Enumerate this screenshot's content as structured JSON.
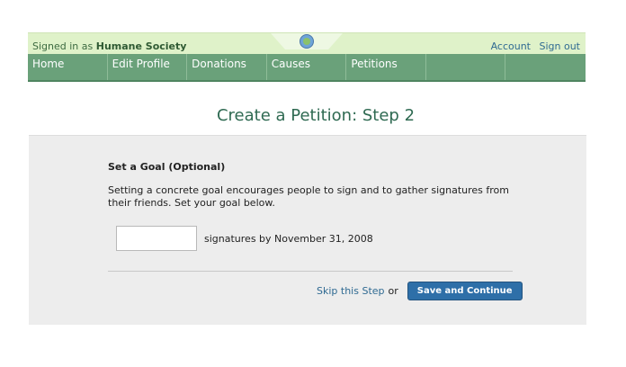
{
  "topbar": {
    "signed_prefix": "Signed in as ",
    "user": "Humane Society",
    "links": [
      "Account",
      "Sign out"
    ]
  },
  "nav": {
    "items": [
      "Home",
      "Edit Profile",
      "Donations",
      "Causes",
      "Petitions",
      "",
      ""
    ]
  },
  "page": {
    "title": "Create a Petition: Step 2"
  },
  "goal": {
    "heading": "Set a Goal (Optional)",
    "description": "Setting a concrete goal encourages people to sign and to gather signatures from their friends. Set your goal below.",
    "input_value": "",
    "suffix": "signatures by November 31, 2008"
  },
  "actions": {
    "skip": "Skip this Step",
    "or": "or",
    "save": "Save and Continue"
  },
  "colors": {
    "nav_bg": "#6aa17a",
    "topbar_bg": "#dff2c9",
    "title": "#2f6a52",
    "button": "#2e6fa8"
  }
}
